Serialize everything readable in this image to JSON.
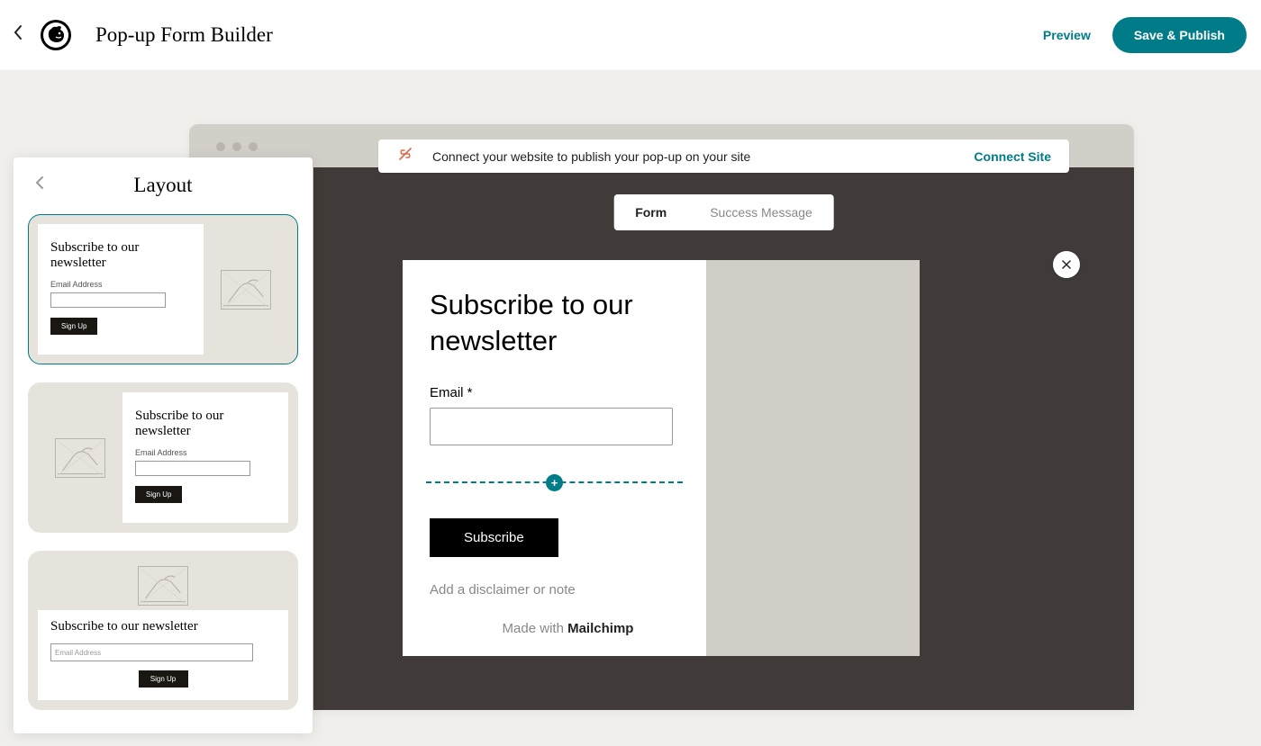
{
  "header": {
    "title": "Pop-up Form Builder",
    "preview": "Preview",
    "save": "Save & Publish"
  },
  "connect": {
    "message": "Connect your website to publish your pop-up on your site",
    "action": "Connect Site"
  },
  "tabs": {
    "form": "Form",
    "success": "Success Message"
  },
  "preview": {
    "title": "Subscribe to our newsletter",
    "emailLabel": "Email *",
    "submit": "Subscribe",
    "disclaimer": "Add a disclaimer or note",
    "madeWith": "Made with ",
    "brand": "Mailchimp"
  },
  "sidebar": {
    "title": "Layout",
    "template": {
      "title": "Subscribe to our newsletter",
      "label": "Email Address",
      "placeholder": "Email Address",
      "button": "Sign Up"
    }
  }
}
